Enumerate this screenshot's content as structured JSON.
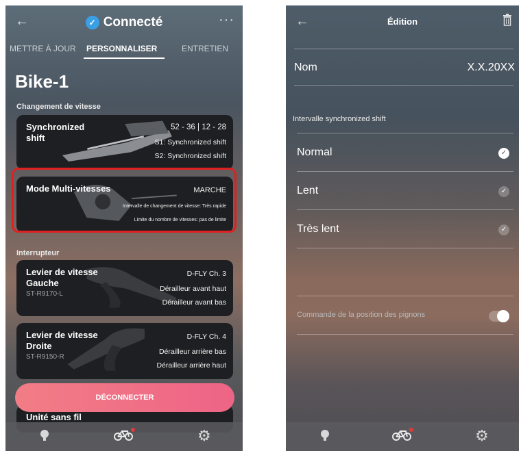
{
  "left": {
    "header": {
      "title": "Connecté",
      "back_icon": "←",
      "more_icon": "···"
    },
    "tabs": [
      "METTRE À JOUR",
      "PERSONNALISER",
      "ENTRETIEN"
    ],
    "bike_name": "Bike-1",
    "sections": {
      "shift": "Changement de vitesse",
      "switch": "Interrupteur"
    },
    "cards": {
      "sync": {
        "title": "Synchronized shift",
        "line1": "52 - 36 | 12 - 28",
        "line2": "S1: Synchronized shift",
        "line3": "S2: Synchronized shift"
      },
      "multi": {
        "title": "Mode Multi-vitesses",
        "line1": "MARCHE",
        "line2": "Intervalle de changement de vitesse: Très rapide",
        "line3": "Limite du nombre de vitesses: pas de limite"
      },
      "left_lever": {
        "title1": "Levier de vitesse",
        "title2": "Gauche",
        "model": "ST-R9170-L",
        "line1": "D-FLY Ch. 3",
        "line2": "Dérailleur avant haut",
        "line3": "Dérailleur avant bas"
      },
      "right_lever": {
        "title1": "Levier de vitesse",
        "title2": "Droite",
        "model": "ST-R9150-R",
        "line1": "D-FLY Ch. 4",
        "line2": "Dérailleur arrière bas",
        "line3": "Dérailleur arrière haut"
      },
      "wireless": {
        "title": "Unité sans fil"
      }
    },
    "disconnect_label": "DÉCONNECTER"
  },
  "right": {
    "title": "Édition",
    "name_label": "Nom",
    "name_value": "X.X.20XX",
    "interval_header": "Intervalle synchronized shift",
    "options": [
      "Normal",
      "Lent",
      "Très lent"
    ],
    "selected_option": "Normal",
    "sprocket_label": "Commande de la position des pignons",
    "sprocket_toggle": true
  },
  "colors": {
    "accent_check": "#3aa0e6",
    "disconnect": "#ee6486",
    "highlight": "#e02020",
    "notification_dot": "#e23a3a"
  }
}
